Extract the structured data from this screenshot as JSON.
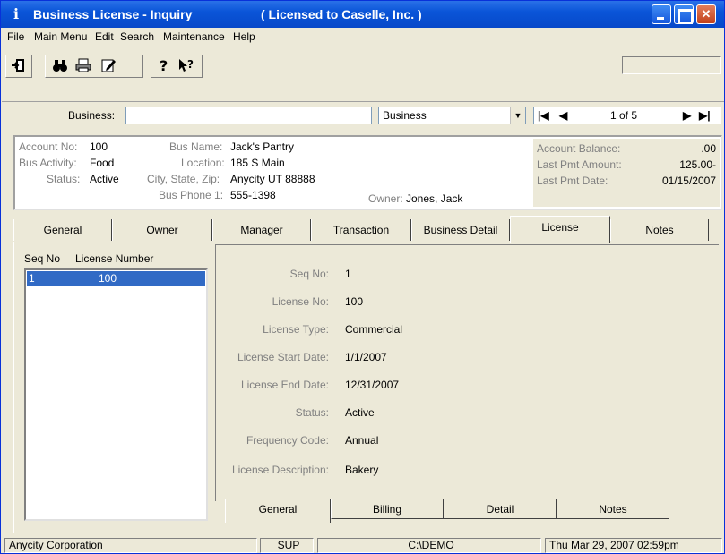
{
  "titlebar": {
    "title": "Business License - Inquiry",
    "license_note": "( Licensed to Caselle, Inc. )"
  },
  "menu": [
    "File",
    "Main Menu",
    "Edit",
    "Search",
    "Maintenance",
    "Help"
  ],
  "toolbar": {
    "icons": [
      "exit-door-icon",
      "binoculars-icon",
      "printer-icon",
      "edit-note-icon",
      "help-icon",
      "whats-this-help-icon"
    ]
  },
  "search": {
    "label": "Business:",
    "value": "",
    "field_type": "Business",
    "position": "1 of 5"
  },
  "account": {
    "account_no_label": "Account No:",
    "account_no": "100",
    "bus_activity_label": "Bus Activity:",
    "bus_activity": "Food",
    "status_label": "Status:",
    "status": "Active",
    "bus_name_label": "Bus Name:",
    "bus_name": "Jack's Pantry",
    "location_label": "Location:",
    "location": "185 S Main",
    "city_label": "City, State, Zip:",
    "city": "Anycity  UT  88888",
    "phone_label": "Bus Phone 1:",
    "phone": "555-1398",
    "owner_label": "Owner:",
    "owner": "Jones, Jack",
    "balance_label": "Account Balance:",
    "balance": ".00",
    "last_pmt_amount_label": "Last Pmt Amount:",
    "last_pmt_amount": "125.00-",
    "last_pmt_date_label": "Last Pmt Date:",
    "last_pmt_date": "01/15/2007"
  },
  "tabs": [
    "General",
    "Owner",
    "Manager",
    "Transaction",
    "Business Detail",
    "License",
    "Notes"
  ],
  "active_tab": "License",
  "license_list": {
    "col_seq": "Seq No",
    "col_license": "License Number",
    "rows": [
      {
        "seq": "1",
        "number": "100"
      }
    ]
  },
  "license_detail": {
    "seq_no_label": "Seq No:",
    "seq_no": "1",
    "license_no_label": "License No:",
    "license_no": "100",
    "license_type_label": "License Type:",
    "license_type": "Commercial",
    "start_date_label": "License Start Date:",
    "start_date": "1/1/2007",
    "end_date_label": "License End Date:",
    "end_date": "12/31/2007",
    "status_label": "Status:",
    "status": "Active",
    "frequency_label": "Frequency Code:",
    "frequency": "Annual",
    "description_label": "License Description:",
    "description": "Bakery"
  },
  "subtabs": [
    "General",
    "Billing",
    "Detail",
    "Notes"
  ],
  "statusbar": {
    "org": "Anycity Corporation",
    "user": "SUP",
    "path": "C:\\DEMO",
    "datetime": "Thu Mar 29, 2007  02:59pm"
  }
}
